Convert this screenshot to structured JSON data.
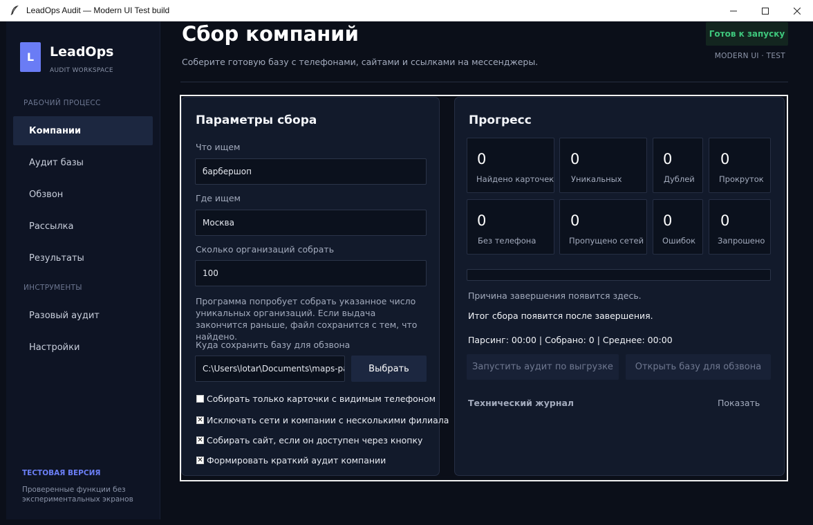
{
  "window": {
    "title": "LeadOps Audit — Modern UI Test build",
    "feather_icon": "feather-icon"
  },
  "sidebar": {
    "logo_letter": "L",
    "brand": "LeadOps",
    "brand_sub": "AUDIT WORKSPACE",
    "section_workflow": "РАБОЧИЙ ПРОЦЕСС",
    "section_tools": "ИНСТРУМЕНТЫ",
    "items": [
      {
        "label": "Компании",
        "active": true
      },
      {
        "label": "Аудит базы",
        "active": false
      },
      {
        "label": "Обзвон",
        "active": false
      },
      {
        "label": "Рассылка",
        "active": false
      },
      {
        "label": "Результаты",
        "active": false
      }
    ],
    "tools": [
      {
        "label": "Разовый аудит"
      },
      {
        "label": "Настройки"
      }
    ],
    "test_label": "ТЕСТОВАЯ ВЕРСИЯ",
    "test_desc": "Проверенные функции без экспериментальных экранов"
  },
  "header": {
    "title": "Сбор компаний",
    "subtitle": "Соберите готовую базу с телефонами, сайтами и ссылками на мессенджеры.",
    "status": "Готов к запуску",
    "mode": "MODERN UI · TEST"
  },
  "params": {
    "title": "Параметры сбора",
    "query_label": "Что ищем",
    "query_value": "барбершоп",
    "location_label": "Где ищем",
    "location_value": "Москва",
    "count_label": "Сколько организаций собрать",
    "count_value": "100",
    "hint": "Программа попробует собрать указанное число уникальных организаций. Если выдача закончится раньше, файл сохранится с тем, что найдено.",
    "save_label": "Куда сохранить базу для обзвона",
    "save_path": "C:\\Users\\lotar\\Documents\\maps-par",
    "choose_button": "Выбрать",
    "options": [
      {
        "label": "Собирать только карточки с видимым телефоном",
        "checked": false
      },
      {
        "label": "Исключать сети и компании с несколькими филиала",
        "checked": true
      },
      {
        "label": "Собирать сайт, если он доступен через кнопку",
        "checked": true
      },
      {
        "label": "Формировать краткий аудит компании",
        "checked": true
      }
    ]
  },
  "progress": {
    "title": "Прогресс",
    "stats": [
      {
        "value": "0",
        "label": "Найдено карточек"
      },
      {
        "value": "0",
        "label": "Уникальных"
      },
      {
        "value": "0",
        "label": "Дублей"
      },
      {
        "value": "0",
        "label": "Прокруток"
      },
      {
        "value": "0",
        "label": "Без телефона"
      },
      {
        "value": "0",
        "label": "Пропущено сетей"
      },
      {
        "value": "0",
        "label": "Ошибок"
      },
      {
        "value": "0",
        "label": "Запрошено"
      }
    ],
    "progress_fraction": 0,
    "reason": "Причина завершения появится здесь.",
    "summary": "Итог сбора появится после завершения.",
    "stats_line": "Парсинг: 00:00 | Собрано: 0 | Среднее: 00:00",
    "btn_audit": "Запустить аудит по выгрузке",
    "btn_open": "Открыть базу для обзвона",
    "log_title": "Технический журнал",
    "log_toggle": "Показать"
  }
}
